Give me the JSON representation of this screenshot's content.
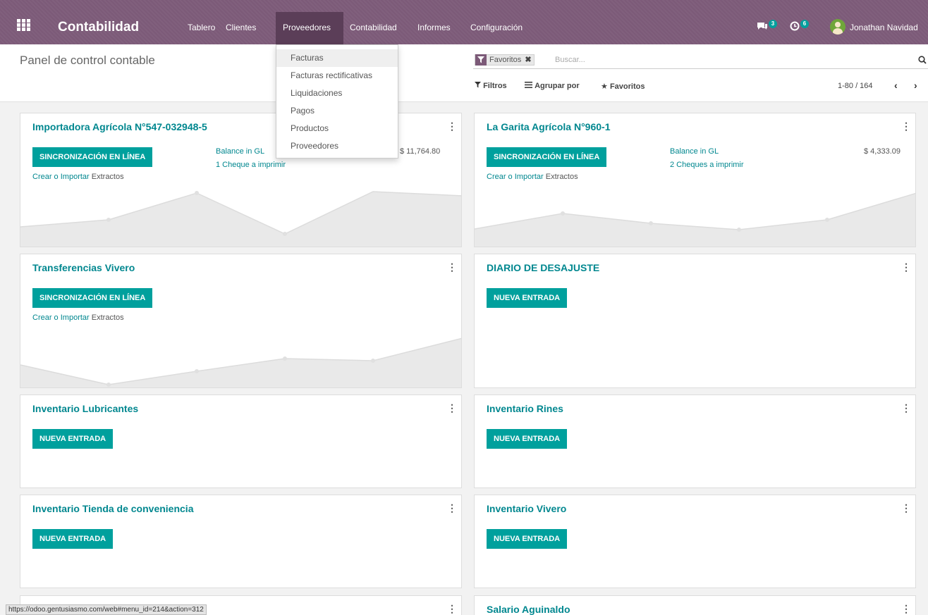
{
  "navbar": {
    "brand": "Contabilidad",
    "menu": [
      "Tablero",
      "Clientes",
      "Proveedores",
      "Contabilidad",
      "Informes",
      "Configuración"
    ],
    "active_menu": "Proveedores",
    "messages_badge": "3",
    "activities_badge": "6",
    "user": "Jonathan Navidad",
    "color": "#7c5a78"
  },
  "dropdown": {
    "items": [
      "Facturas",
      "Facturas rectificativas",
      "Liquidaciones",
      "Pagos",
      "Productos",
      "Proveedores"
    ],
    "highlighted": "Facturas"
  },
  "control_panel": {
    "title": "Panel de control contable",
    "facet": "Favoritos",
    "search_placeholder": "Buscar...",
    "filters": "Filtros",
    "group_by": "Agrupar por",
    "favorites": "Favoritos",
    "pager": "1-80 / 164"
  },
  "cards": [
    {
      "title": "Importadora Agrícola N°547-032948-5",
      "button": "SINCRONIZACIÓN EN LÍNEA",
      "link_prefix": "Crear o Importar",
      "link_suffix": " Extractos",
      "balance_label": "Balance in GL",
      "balance_value": "$ 11,764.80",
      "cheques": "1 Cheque a imprimir"
    },
    {
      "title": "La Garita Agrícola N°960-1",
      "button": "SINCRONIZACIÓN EN LÍNEA",
      "link_prefix": "Crear o Importar",
      "link_suffix": " Extractos",
      "balance_label": "Balance in GL",
      "balance_value": "$ 4,333.09",
      "cheques": "2 Cheques a imprimir"
    },
    {
      "title": "Transferencias Vivero",
      "button": "SINCRONIZACIÓN EN LÍNEA",
      "link_prefix": "Crear o Importar",
      "link_suffix": " Extractos"
    },
    {
      "title": "DIARIO DE DESAJUSTE",
      "button": "NUEVA ENTRADA"
    },
    {
      "title": "Inventario Lubricantes",
      "button": "NUEVA ENTRADA"
    },
    {
      "title": "Inventario Rines",
      "button": "NUEVA ENTRADA"
    },
    {
      "title": "Inventario Tienda de conveniencia",
      "button": "NUEVA ENTRADA"
    },
    {
      "title": "Inventario Vivero",
      "button": "NUEVA ENTRADA"
    },
    {
      "title": "Salario Aguinaldo",
      "button": ""
    }
  ],
  "status_url": "https://odoo.gentusiasmo.com/web#menu_id=214&action=312",
  "colors": {
    "accent": "#00a09d",
    "link": "#00878f"
  }
}
